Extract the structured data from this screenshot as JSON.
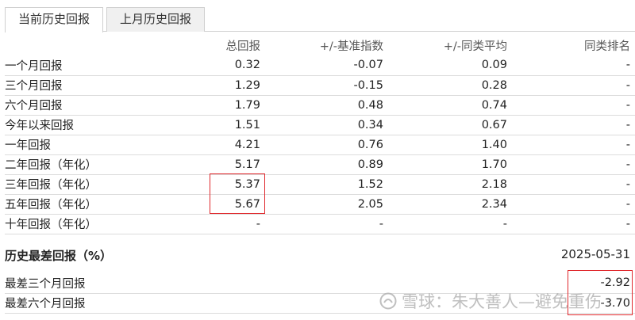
{
  "tabs": [
    {
      "label": "当前历史回报"
    },
    {
      "label": "上月历史回报"
    }
  ],
  "returns": {
    "headers": [
      "",
      "总回报",
      "+/-基准指数",
      "+/-同类平均",
      "同类排名"
    ],
    "rows": [
      {
        "label": "一个月回报",
        "total": "0.32",
        "bench": "-0.07",
        "avg": "0.09",
        "rank": "-"
      },
      {
        "label": "三个月回报",
        "total": "1.29",
        "bench": "-0.15",
        "avg": "0.28",
        "rank": "-"
      },
      {
        "label": "六个月回报",
        "total": "1.79",
        "bench": "0.48",
        "avg": "0.74",
        "rank": "-"
      },
      {
        "label": "今年以来回报",
        "total": "1.51",
        "bench": "0.34",
        "avg": "0.67",
        "rank": "-"
      },
      {
        "label": "一年回报",
        "total": "4.21",
        "bench": "0.76",
        "avg": "1.40",
        "rank": "-"
      },
      {
        "label": "二年回报（年化）",
        "total": "5.17",
        "bench": "0.89",
        "avg": "1.70",
        "rank": "-"
      },
      {
        "label": "三年回报（年化）",
        "total": "5.37",
        "bench": "1.52",
        "avg": "2.18",
        "rank": "-"
      },
      {
        "label": "五年回报（年化）",
        "total": "5.67",
        "bench": "2.05",
        "avg": "2.34",
        "rank": "-"
      },
      {
        "label": "十年回报（年化）",
        "total": "-",
        "bench": "-",
        "avg": "-",
        "rank": "-"
      }
    ]
  },
  "history": {
    "title": "历史最差回报（%）",
    "date": "2025-05-31",
    "rows": [
      {
        "label": "最差三个月回报",
        "value": "-2.92"
      },
      {
        "label": "最差六个月回报",
        "value": "-3.70"
      }
    ]
  },
  "watermark": {
    "text": "雪球：朱大善人—避免重伤"
  },
  "colors": {
    "highlight": "#e0292d",
    "border": "#dcdcdc",
    "inactive_tab": "#f0f0f0"
  }
}
